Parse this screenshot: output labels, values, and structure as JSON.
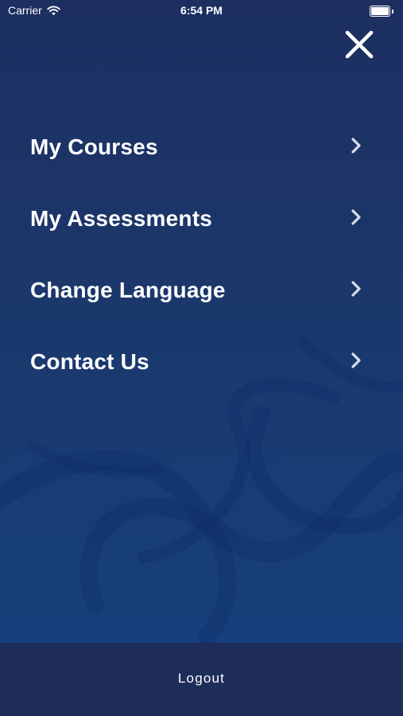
{
  "status_bar": {
    "carrier": "Carrier",
    "time": "6:54 PM",
    "battery_level": 1.0
  },
  "close": {
    "icon": "close-icon"
  },
  "menu": {
    "items": [
      {
        "label": "My Courses",
        "icon": "chevron-right-icon"
      },
      {
        "label": "My Assessments",
        "icon": "chevron-right-icon"
      },
      {
        "label": "Change Language",
        "icon": "chevron-right-icon"
      },
      {
        "label": "Contact Us",
        "icon": "chevron-right-icon"
      }
    ]
  },
  "footer": {
    "logout_label": "Logout"
  },
  "colors": {
    "background_top": "#1d2f61",
    "background_bottom": "#15427f",
    "footer": "#1e2d59",
    "text": "#ffffff",
    "chevron": "#d8dde8"
  }
}
